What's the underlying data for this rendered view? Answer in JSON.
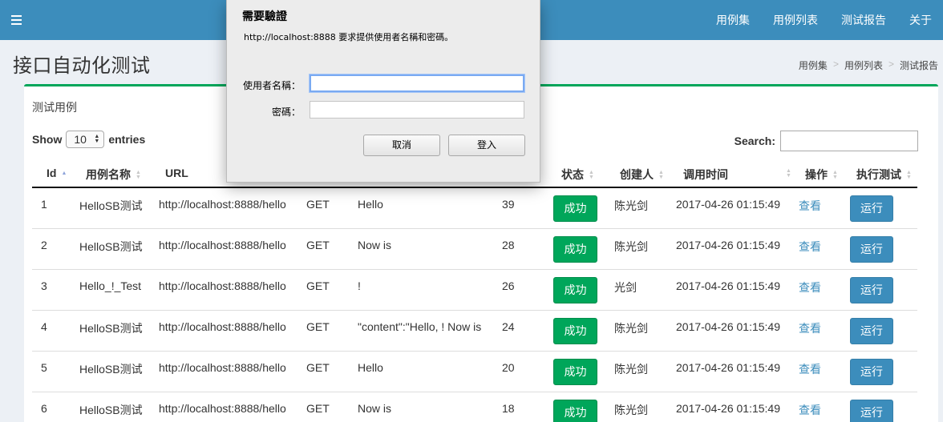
{
  "navbar": {
    "links": [
      "用例集",
      "用例列表",
      "测试报告",
      "关于"
    ]
  },
  "page": {
    "title": "接口自动化测试",
    "breadcrumb": [
      "用例集",
      "用例列表",
      "测试报告"
    ],
    "breadcrumb_sep": ">"
  },
  "box": {
    "title": "测试用例",
    "show_prefix": "Show",
    "show_value": "10",
    "show_suffix": "entries",
    "search_label": "Search:",
    "search_value": ""
  },
  "table": {
    "columns": {
      "id": "Id",
      "name": "用例名称",
      "url": "URL",
      "status": "状态",
      "creator": "创建人",
      "time": "调用时间",
      "action": "操作",
      "run": "执行测试"
    },
    "rows": [
      {
        "id": "1",
        "name": "HelloSB测试",
        "url": "http://localhost:8888/hello",
        "method": "GET",
        "expect": "Hello",
        "count": "39",
        "status": "成功",
        "creator": "陈光剑",
        "time": "2017-04-26 01:15:49",
        "view": "查看",
        "run": "运行"
      },
      {
        "id": "2",
        "name": "HelloSB测试",
        "url": "http://localhost:8888/hello",
        "method": "GET",
        "expect": "Now is",
        "count": "28",
        "status": "成功",
        "creator": "陈光剑",
        "time": "2017-04-26 01:15:49",
        "view": "查看",
        "run": "运行"
      },
      {
        "id": "3",
        "name": "Hello_!_Test",
        "url": "http://localhost:8888/hello",
        "method": "GET",
        "expect": "!",
        "count": "26",
        "status": "成功",
        "creator": "光剑",
        "time": "2017-04-26 01:15:49",
        "view": "查看",
        "run": "运行"
      },
      {
        "id": "4",
        "name": "HelloSB测试",
        "url": "http://localhost:8888/hello",
        "method": "GET",
        "expect": "\"content\":\"Hello, ! Now is",
        "count": "24",
        "status": "成功",
        "creator": "陈光剑",
        "time": "2017-04-26 01:15:49",
        "view": "查看",
        "run": "运行"
      },
      {
        "id": "5",
        "name": "HelloSB测试",
        "url": "http://localhost:8888/hello",
        "method": "GET",
        "expect": "Hello",
        "count": "20",
        "status": "成功",
        "creator": "陈光剑",
        "time": "2017-04-26 01:15:49",
        "view": "查看",
        "run": "运行"
      },
      {
        "id": "6",
        "name": "HelloSB测试",
        "url": "http://localhost:8888/hello",
        "method": "GET",
        "expect": "Now is",
        "count": "18",
        "status": "成功",
        "creator": "陈光剑",
        "time": "2017-04-26 01:15:49",
        "view": "查看",
        "run": "运行"
      }
    ]
  },
  "dialog": {
    "title": "需要驗證",
    "message": "http://localhost:8888 要求提供使用者名稱和密碼。",
    "username_label": "使用者名稱：",
    "password_label": "密碼：",
    "username_value": "",
    "password_value": "",
    "cancel_label": "取消",
    "login_label": "登入"
  },
  "colors": {
    "navbar": "#3c8dbc",
    "box_accent": "#00a65a",
    "success_badge": "#00a65a",
    "run_button": "#3c8dbc",
    "link": "#3c8dbc"
  },
  "icons": [
    "hamburger-menu-icon",
    "sort-asc-icon",
    "sort-both-icon",
    "select-arrows-icon"
  ]
}
